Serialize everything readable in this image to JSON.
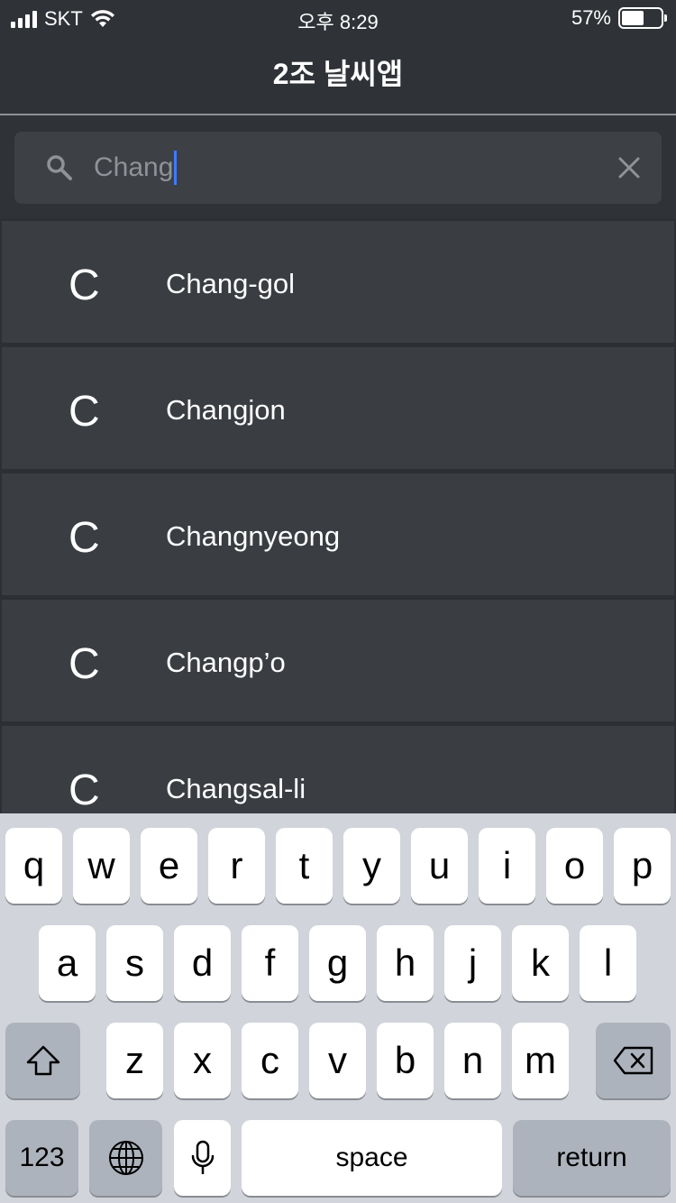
{
  "status_bar": {
    "carrier": "SKT",
    "time": "오후 8:29",
    "battery_percent": "57%",
    "battery_level": 0.57
  },
  "nav": {
    "title": "2조 날씨앱"
  },
  "search": {
    "value": "Chang"
  },
  "results": [
    {
      "initial": "C",
      "name": "Chang-gol"
    },
    {
      "initial": "C",
      "name": "Changjon"
    },
    {
      "initial": "C",
      "name": "Changnyeong"
    },
    {
      "initial": "C",
      "name": "Changp’o"
    },
    {
      "initial": "C",
      "name": "Changsal-li"
    }
  ],
  "keyboard": {
    "row1": [
      "q",
      "w",
      "e",
      "r",
      "t",
      "y",
      "u",
      "i",
      "o",
      "p"
    ],
    "row2": [
      "a",
      "s",
      "d",
      "f",
      "g",
      "h",
      "j",
      "k",
      "l"
    ],
    "row3": [
      "z",
      "x",
      "c",
      "v",
      "b",
      "n",
      "m"
    ],
    "numbers_label": "123",
    "space_label": "space",
    "return_label": "return"
  },
  "icons": {
    "search": "search-icon",
    "clear": "close-icon",
    "wifi": "wifi-icon",
    "signal": "signal-icon",
    "battery": "battery-icon",
    "shift": "shift-icon",
    "delete": "backspace-icon",
    "globe": "globe-icon",
    "mic": "microphone-icon"
  },
  "colors": {
    "background": "#3a3d42",
    "header": "#2f3236",
    "caret": "#3d7bff",
    "keyboard": "#d1d4da"
  }
}
